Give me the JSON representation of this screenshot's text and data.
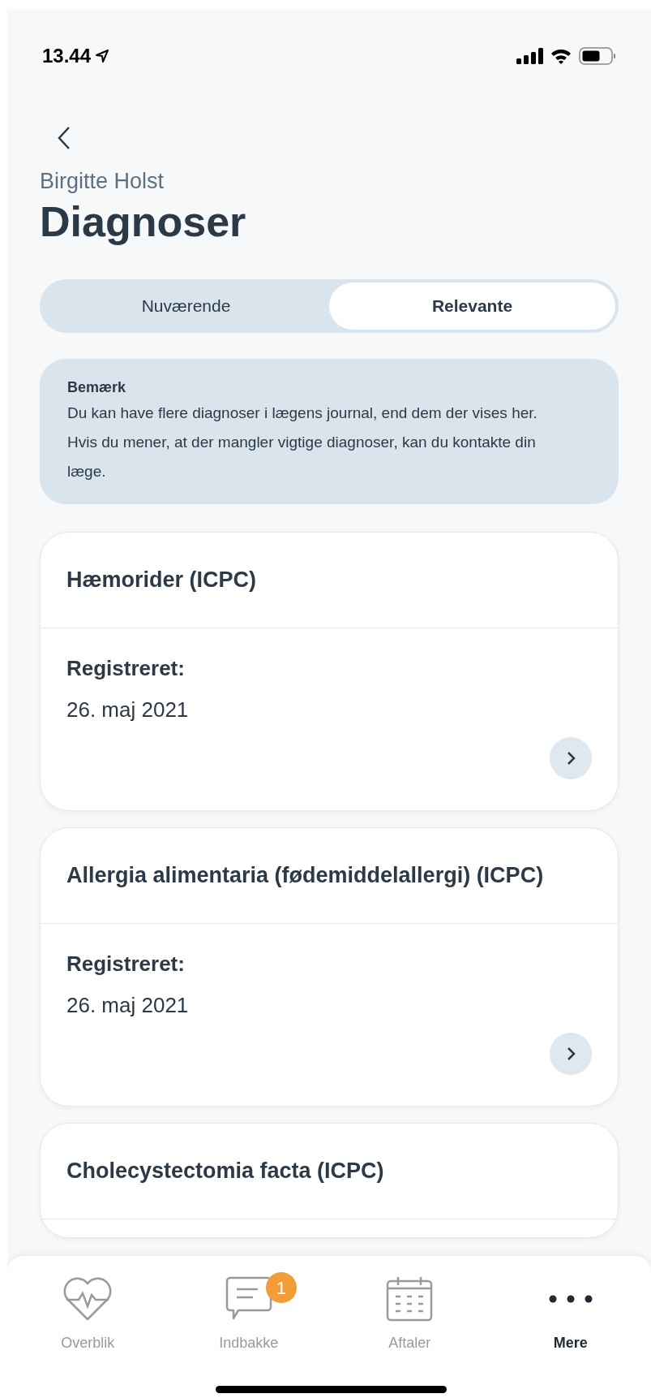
{
  "status_bar": {
    "time": "13.44"
  },
  "header": {
    "subtitle": "Birgitte Holst",
    "title": "Diagnoser"
  },
  "tabs": [
    {
      "label": "Nuværende",
      "selected": false
    },
    {
      "label": "Relevante",
      "selected": true
    }
  ],
  "note": {
    "title": "Bemærk",
    "text": "Du kan have flere diagnoser i lægens journal, end dem der vises her. Hvis du mener, at der mangler vigtige diagnoser, kan du kontakte din læge."
  },
  "diagnoses": [
    {
      "name": "Hæmorider (ICPC)",
      "label": "Registreret:",
      "date": "26. maj 2021"
    },
    {
      "name": "Allergia alimentaria (fødemiddelallergi) (ICPC)",
      "label": "Registreret:",
      "date": "26. maj 2021"
    },
    {
      "name": "Cholecystectomia facta (ICPC)"
    }
  ],
  "tab_bar": [
    {
      "kind": "heart",
      "label": "Overblik",
      "selected": false
    },
    {
      "kind": "chat",
      "label": "Indbakke",
      "selected": false,
      "badge": "1"
    },
    {
      "kind": "calendar",
      "label": "Aftaler",
      "selected": false
    },
    {
      "kind": "more",
      "label": "Mere",
      "selected": true
    }
  ]
}
